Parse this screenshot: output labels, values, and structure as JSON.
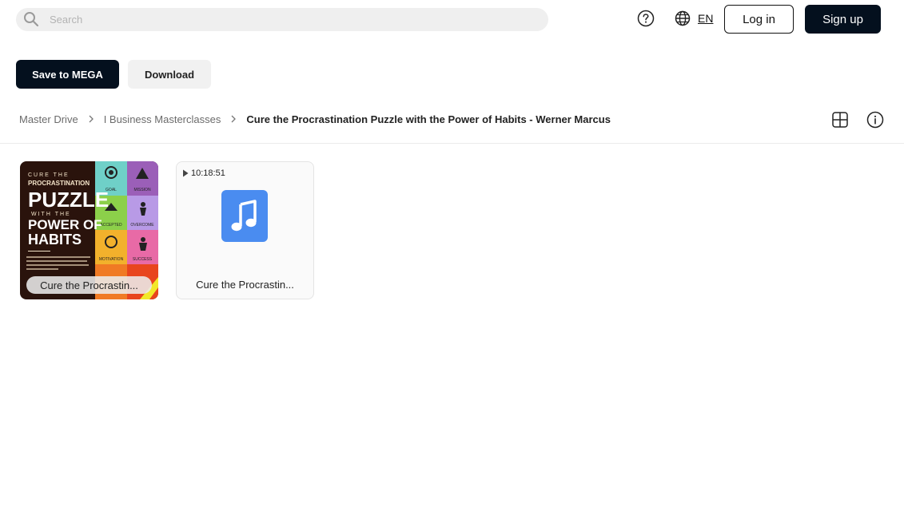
{
  "header": {
    "search": {
      "placeholder": "Search",
      "value": ""
    },
    "language": "EN",
    "login_label": "Log in",
    "signup_label": "Sign up"
  },
  "toolbar": {
    "save_label": "Save to MEGA",
    "download_label": "Download"
  },
  "breadcrumb": {
    "items": [
      "Master Drive",
      "I Business Masterclasses"
    ],
    "current": "Cure the Procrastination Puzzle with the Power of Habits - Werner Marcus"
  },
  "files": [
    {
      "name": "Cure the Procrastin...",
      "type": "image",
      "icon": "book-cover-thumbnail"
    },
    {
      "name": "Cure the Procrastin...",
      "type": "audio",
      "duration": "10:18:51",
      "icon": "music-note-icon"
    }
  ],
  "cover": {
    "line1": "CURE THE",
    "line2": "PROCRASTINATION",
    "line3": "PUZZLE",
    "line4": "WITH THE",
    "line5": "POWER OF",
    "line6": "HABITS",
    "tiles": [
      "GOAL",
      "MISSION",
      "ACCEPTED",
      "OVERCOME",
      "MOTIVATION",
      "SUCCESS"
    ]
  },
  "colors": {
    "primary": "#04101e",
    "cover_background": "#2a130c",
    "music_icon": "#4a8cf0"
  }
}
